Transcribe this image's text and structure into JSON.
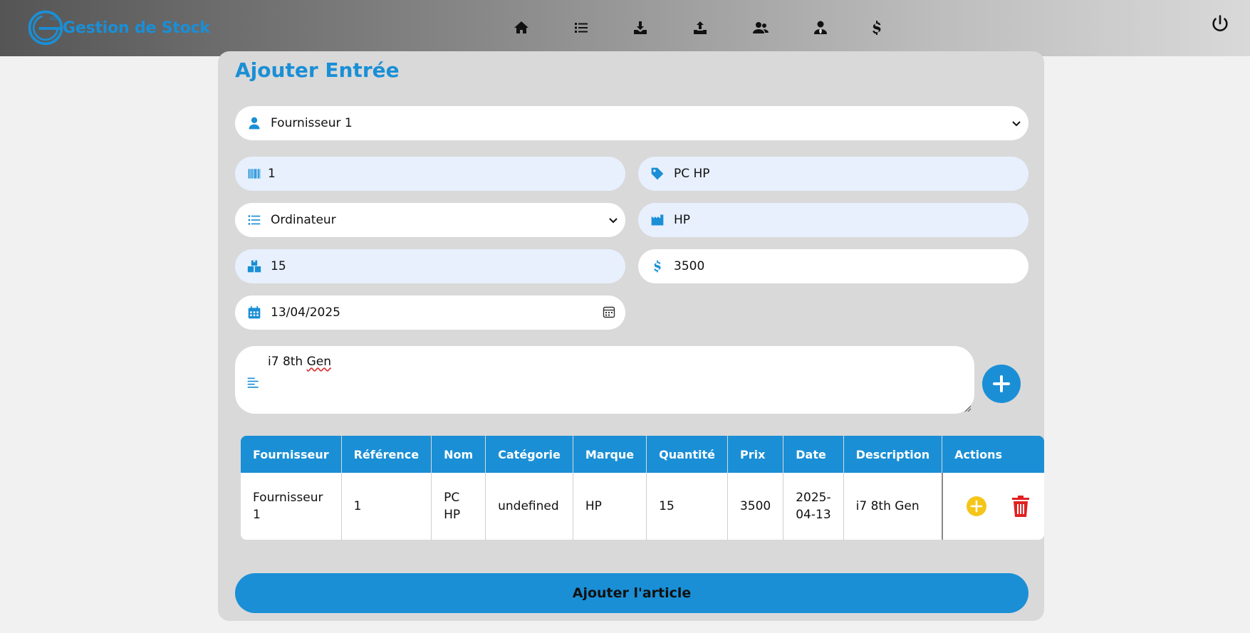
{
  "app": {
    "brand_name": "Gestion de Stock",
    "logo_text": "GDS",
    "accent_color": "#1a8fd6"
  },
  "nav": {
    "icons": [
      "home-icon",
      "list-icon",
      "download-icon",
      "upload-icon",
      "users-icon",
      "user-tie-icon",
      "dollar-icon"
    ],
    "logout_icon": "power-icon"
  },
  "form": {
    "title": "Ajouter Entrée",
    "fournisseur": "Fournisseur 1",
    "reference": "1",
    "nom": "PC HP",
    "categorie": "Ordinateur",
    "marque": "HP",
    "quantite": "15",
    "prix": "3500",
    "date": "13/04/2025",
    "description": "i7 8th Gen",
    "description_first": "i7 8th ",
    "description_misspelled": "Gen"
  },
  "table": {
    "headers": [
      "Fournisseur",
      "Référence",
      "Nom",
      "Catégorie",
      "Marque",
      "Quantité",
      "Prix",
      "Date",
      "Description",
      "Actions"
    ],
    "rows": [
      {
        "fournisseur": "Fournisseur 1",
        "reference": "1",
        "nom": "PC HP",
        "categorie": "undefined",
        "marque": "HP",
        "quantite": "15",
        "prix": "3500",
        "date": "2025-04-13",
        "description": "i7 8th Gen"
      }
    ],
    "action_icons": [
      "plus-circle-icon",
      "trash-icon"
    ],
    "action_colors": {
      "add": "#f5c518",
      "delete": "#e02020"
    }
  },
  "submit_label": "Ajouter l'article"
}
